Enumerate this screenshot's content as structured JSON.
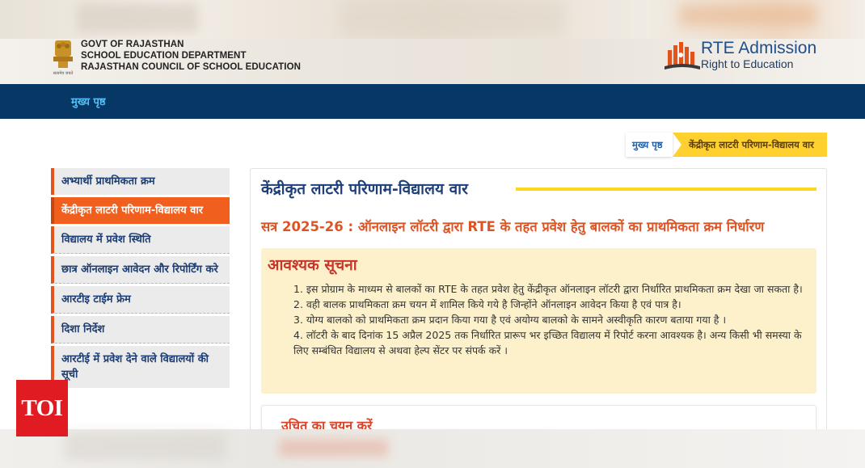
{
  "header": {
    "govt_line1": "GOVT OF RAJASTHAN",
    "govt_line2": "SCHOOL EDUCATION DEPARTMENT",
    "govt_line3": "RAJASTHAN COUNCIL OF SCHOOL EDUCATION",
    "emblem_caption": "सत्यमेव जयते",
    "rte_title": "RTE Admission",
    "rte_subtitle": "Right to Education"
  },
  "nav": {
    "home_label": "मुख्य पृष्ठ"
  },
  "breadcrumb": {
    "home": "मुख्य पृष्ठ",
    "current": "केंद्रीकृत लाटरी परिणाम-विद्यालय वार"
  },
  "sidebar": {
    "items": [
      {
        "label": "अभ्यार्थी प्राथमिकता क्रम"
      },
      {
        "label": "केंद्रीकृत लाटरी परिणाम-विद्यालय वार"
      },
      {
        "label": "विद्यालय में प्रवेश स्थिति"
      },
      {
        "label": "छात्र ऑनलाइन आवेदन और रिपोर्टिंग करे"
      },
      {
        "label": "आरटीइ टाईम फ्रेम"
      },
      {
        "label": "दिशा निर्देश"
      },
      {
        "label": "आरटीई में प्रवेश देने वाले विद्यालयों की सूची"
      }
    ]
  },
  "main": {
    "title": "केंद्रीकृत लाटरी परिणाम-विद्यालय वार",
    "session_line": "सत्र 2025-26 : ऑनलाइन लॉटरी द्वारा RTE के तहत प्रवेश हेतु बालकों का प्राथमिकता क्रम निर्धारण",
    "notice": {
      "heading": "आवश्यक सूचना",
      "points": [
        "1. इस प्रोग्राम के माध्यम से बालकों का RTE के तहत प्रवेश हेतु केंद्रीकृत ऑनलाइन लॉटरी द्वारा निर्धारित प्राथमिकता क्रम देखा जा सकता है।",
        "2. वही बालक प्राथमिकता क्रम चयन में शामिल किये गये है जिन्होंने ऑनलाइन आवेदन किया है एवं पात्र है।",
        "3. योग्य बालको को प्राथमिकता क्रम प्रदान किया गया है एवं अयोग्य बालको के सामने अस्वीकृति कारण बताया गया है ।",
        "4. लॉटरी के बाद दिनांक 15 अप्रैल 2025 तक निर्धारित प्रारूप भर इच्छित विद्यालय में रिपोर्ट करना आवश्यक है। अन्य किसी भी समस्या के लिए सम्बंधित विद्यालय से अथवा हेल्प सेंटर पर संपर्क करें ।"
      ]
    },
    "select_heading": "उचित का चयन करें"
  },
  "watermark": {
    "label": "TOI"
  },
  "colors": {
    "navbar": "#073764",
    "sidebar_accent": "#e2531e",
    "active_item": "#f05f1e",
    "breadcrumb_current": "#ffd12e",
    "title_rule": "#ffd61f",
    "notice_bg": "#fdf1cb",
    "toi_red": "#e11b22"
  }
}
